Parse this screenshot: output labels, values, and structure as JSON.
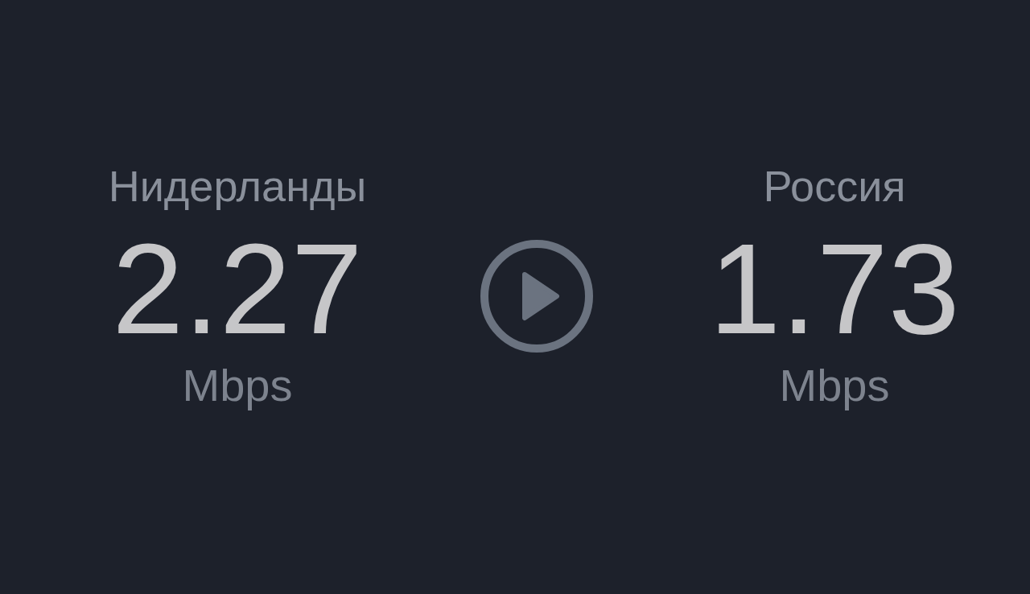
{
  "speeds": [
    {
      "location": "Нидерланды",
      "value": "2.27",
      "unit": "Mbps"
    },
    {
      "location": "Россия",
      "value": "1.73",
      "unit": "Mbps"
    }
  ]
}
